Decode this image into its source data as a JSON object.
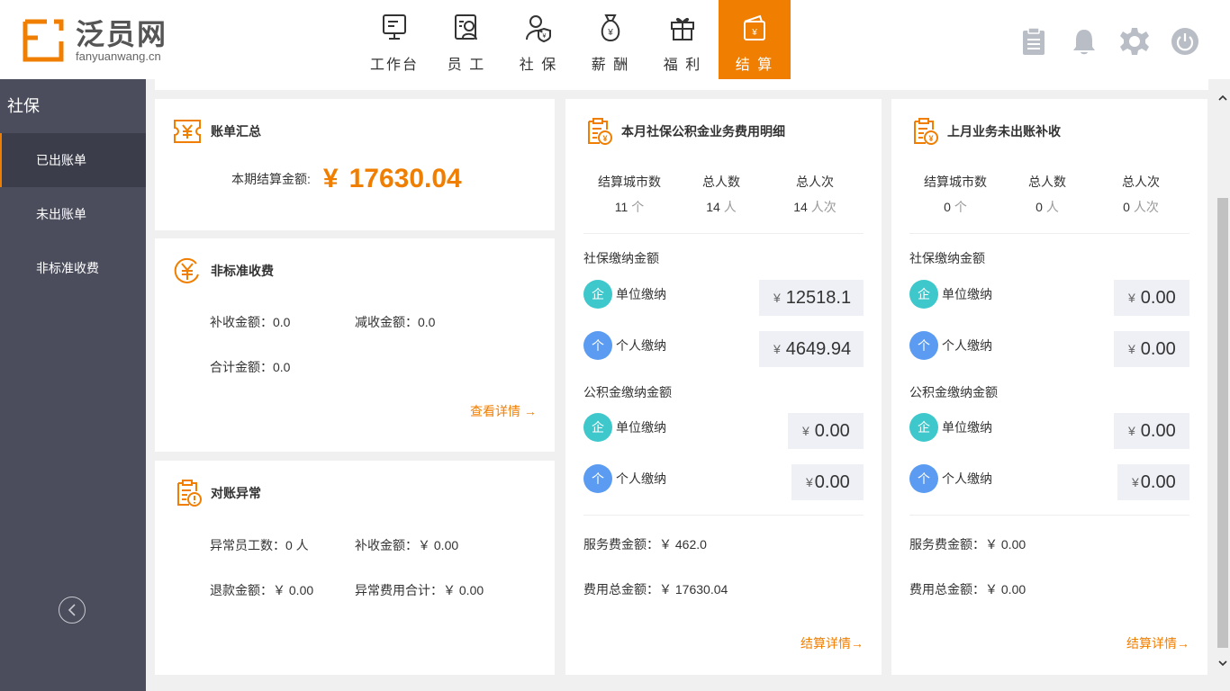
{
  "brand": {
    "name_cn": "泛员网",
    "name_en": "fanyuanwang.cn",
    "accent": "#f07e00"
  },
  "nav": [
    {
      "label": "工作台",
      "icon": "dashboard-icon"
    },
    {
      "label": "员 工",
      "icon": "employee-icon"
    },
    {
      "label": "社 保",
      "icon": "social-security-icon"
    },
    {
      "label": "薪 酬",
      "icon": "salary-icon"
    },
    {
      "label": "福 利",
      "icon": "gift-icon"
    },
    {
      "label": "结 算",
      "icon": "settlement-icon"
    }
  ],
  "sidebar": {
    "title": "社保",
    "items": [
      {
        "label": "已出账单"
      },
      {
        "label": "未出账单"
      },
      {
        "label": "非标准收费"
      }
    ]
  },
  "bill_summary": {
    "title": "账单汇总",
    "amount_label": "本期结算金额:",
    "currency": "¥",
    "amount": "17630.04"
  },
  "nonstandard": {
    "title": "非标准收费",
    "supplement": "补收金额：0.0",
    "reduction": "减收金额：0.0",
    "total": "合计金额：0.0",
    "detail_link": "查看详情 →"
  },
  "reconcile": {
    "title": "对账异常",
    "abnormal_employees": "异常员工数：0 人",
    "supplement": "补收金额：￥ 0.00",
    "refund": "退款金额：￥ 0.00",
    "abnormal_total": "异常费用合计：￥ 0.00"
  },
  "current_month": {
    "title": "本月社保公积金业务费用明细",
    "stats": [
      {
        "label": "结算城市数",
        "value": "11",
        "unit": "个"
      },
      {
        "label": "总人数",
        "value": "14",
        "unit": "人"
      },
      {
        "label": "总人次",
        "value": "14",
        "unit": "人次"
      }
    ],
    "social_label": "社保缴纳金额",
    "fund_label": "公积金缴纳金额",
    "company_badge": "企",
    "personal_badge": "个",
    "company_label": "单位缴纳",
    "personal_label": "个人缴纳",
    "social_company": "12518.1",
    "social_personal": "4649.94",
    "fund_company": "0.00",
    "fund_personal": "0.00",
    "yen": "¥",
    "service_fee": "服务费金额：￥ 462.0",
    "total_fee": "费用总金额：￥ 17630.04",
    "detail_link": "结算详情→"
  },
  "last_month": {
    "title": "上月业务未出账补收",
    "stats": [
      {
        "label": "结算城市数",
        "value": "0",
        "unit": "个"
      },
      {
        "label": "总人数",
        "value": "0",
        "unit": "人"
      },
      {
        "label": "总人次",
        "value": "0",
        "unit": "人次"
      }
    ],
    "social_label": "社保缴纳金额",
    "fund_label": "公积金缴纳金额",
    "company_badge": "企",
    "personal_badge": "个",
    "company_label": "单位缴纳",
    "personal_label": "个人缴纳",
    "social_company": "0.00",
    "social_personal": "0.00",
    "fund_company": "0.00",
    "fund_personal": "0.00",
    "yen": "¥",
    "service_fee": "服务费金额：￥ 0.00",
    "total_fee": "费用总金额：￥ 0.00",
    "detail_link": "结算详情→"
  }
}
